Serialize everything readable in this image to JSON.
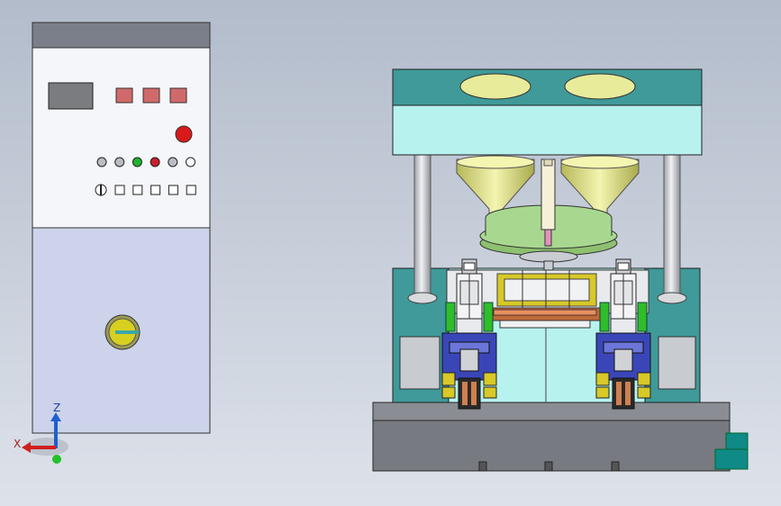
{
  "viewport": {
    "background_top": "#b3bccb",
    "background_bottom": "#dde2ea"
  },
  "triad": {
    "z_label": "Z",
    "x_label": "X",
    "z_color": "#1f5fd1",
    "x_color": "#d11f1f",
    "y_color": "#22c22a"
  },
  "control_cabinet": {
    "top_band_color": "#7b7f89",
    "upper_panel_color": "#f4f6fa",
    "lower_panel_color": "#ccd3ea",
    "display_color": "#7a7c80",
    "button_color": "#d06a6a",
    "emergency_stop_color": "#d81a1a",
    "indicator_lights": [
      "#b8bcc4",
      "#b8bcc4",
      "#1fb330",
      "#c8202a",
      "#b8bcc4",
      "#ffffff"
    ],
    "switch_count": 6,
    "key_switch_color": "#d8d020"
  },
  "machine": {
    "frame_color": "#3f9a99",
    "frame_light_color": "#b8f2ee",
    "hopper_color": "#e8eb9a",
    "turntable_color": "#a8d890",
    "column_color": "#c9ccd2",
    "base_color": "#777a80",
    "base_top_color": "#8a8d93",
    "pump_color": "#0f8a86",
    "head_blue": "#3a46b8",
    "head_yellow": "#d8c828"
  }
}
